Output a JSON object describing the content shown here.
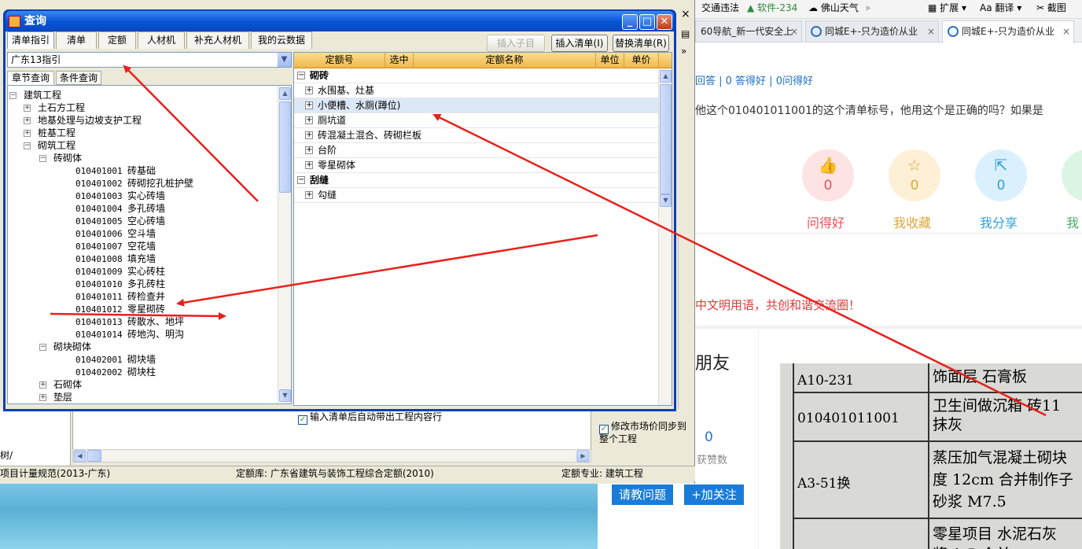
{
  "browser": {
    "bookmarks": [
      "交通违法",
      "软件-234",
      "佛山天气",
      "»",
      "扩展",
      "翻译",
      "截图"
    ],
    "tabs": [
      {
        "label": "60导航_新一代安全上",
        "close": "×"
      },
      {
        "label": "同城E+-只为造价从业",
        "close": "×"
      },
      {
        "label": "同城E+-只为造价从业",
        "close": "×"
      }
    ]
  },
  "page": {
    "stats": "回答 | 0 答得好 | 0问得好",
    "question": "他这个010401011001的这个清单标号，他用这个是正确的吗？如果是",
    "actions": [
      {
        "count": "0",
        "label": "问得好",
        "color": "#e8505b",
        "bg": "#fde3e3"
      },
      {
        "count": "0",
        "label": "我收藏",
        "color": "#e1a53a",
        "bg": "#fdf0d6"
      },
      {
        "count": "0",
        "label": "我分享",
        "color": "#2e9fe0",
        "bg": "#daf0fc"
      },
      {
        "count": "",
        "label": "我",
        "color": "#3fb36b",
        "bg": "#dcf5e4"
      }
    ],
    "civility": "中文明用语，共创和谐交流圈！",
    "friends": "朋友",
    "likes_count": "0",
    "likes_label": "获赞数",
    "ask_button": "请教问题",
    "follow_button": "+加关注"
  },
  "photo": {
    "rows": [
      {
        "code": "A10-231",
        "desc": "饰面层 石膏板"
      },
      {
        "code": "010401011001",
        "desc": "卫生间做沉箱 砖11\n抹灰"
      },
      {
        "code": "A3-51换",
        "desc": "蒸压加气混凝土砌块\n度 12cm 合并制作子\n砂浆 M7.5"
      },
      {
        "code": "",
        "desc": "零星项目 水泥石灰\n浆 1:5 合并"
      }
    ]
  },
  "app": {
    "status": {
      "norm": "项目计量规范(2013-广东)",
      "quota_lib": "定额库: 广东省建筑与装饰工程综合定额(2010)",
      "quota_major": "定额专业: 建筑工程"
    },
    "sync_option": "修改市场价同步到整个工程",
    "side_tab": "树/"
  },
  "dialog": {
    "title": "查询",
    "tabs": [
      "清单指引",
      "清单",
      "定额",
      "人材机",
      "补充人材机",
      "我的云数据"
    ],
    "active_tab": "清单指引",
    "buttons": {
      "insert_child": "插入子目",
      "insert_list": "插入清单(I)",
      "replace_list": "替换清单(R)"
    },
    "combo_value": "广东13指引",
    "subtabs": [
      "章节查询",
      "条件查询"
    ],
    "tree": [
      {
        "level": 0,
        "toggle": "−",
        "label": "建筑工程"
      },
      {
        "level": 1,
        "toggle": "+",
        "label": "土石方工程"
      },
      {
        "level": 1,
        "toggle": "+",
        "label": "地基处理与边坡支护工程"
      },
      {
        "level": 1,
        "toggle": "+",
        "label": "桩基工程"
      },
      {
        "level": 1,
        "toggle": "−",
        "label": "砌筑工程"
      },
      {
        "level": 2,
        "toggle": "−",
        "label": "砖砌体"
      },
      {
        "level": 3,
        "code": "010401001",
        "label": "砖基础"
      },
      {
        "level": 3,
        "code": "010401002",
        "label": "砖砌挖孔桩护壁"
      },
      {
        "level": 3,
        "code": "010401003",
        "label": "实心砖墙"
      },
      {
        "level": 3,
        "code": "010401004",
        "label": "多孔砖墙"
      },
      {
        "level": 3,
        "code": "010401005",
        "label": "空心砖墙"
      },
      {
        "level": 3,
        "code": "010401006",
        "label": "空斗墙"
      },
      {
        "level": 3,
        "code": "010401007",
        "label": "空花墙"
      },
      {
        "level": 3,
        "code": "010401008",
        "label": "填充墙"
      },
      {
        "level": 3,
        "code": "010401009",
        "label": "实心砖柱"
      },
      {
        "level": 3,
        "code": "010401010",
        "label": "多孔砖柱"
      },
      {
        "level": 3,
        "code": "010401011",
        "label": "砖检查井"
      },
      {
        "level": 3,
        "code": "010401012",
        "label": "零星砌砖"
      },
      {
        "level": 3,
        "code": "010401013",
        "label": "砖散水、地坪"
      },
      {
        "level": 3,
        "code": "010401014",
        "label": "砖地沟、明沟"
      },
      {
        "level": 2,
        "toggle": "−",
        "label": "砌块砌体"
      },
      {
        "level": 3,
        "code": "010402001",
        "label": "砌块墙"
      },
      {
        "level": 3,
        "code": "010402002",
        "label": "砌块柱"
      },
      {
        "level": 2,
        "toggle": "+",
        "label": "石砌体"
      },
      {
        "level": 2,
        "toggle": "+",
        "label": "垫层"
      }
    ],
    "grid_headers": [
      "定额号",
      "选中",
      "定额名称",
      "单位",
      "单价"
    ],
    "grid_rows": [
      {
        "group": true,
        "toggle": "−",
        "label": "砌砖"
      },
      {
        "toggle": "+",
        "label": "水围基、灶基"
      },
      {
        "toggle": "+",
        "label": "小便槽、水厕(蹲位)",
        "selected": true
      },
      {
        "toggle": "+",
        "label": "厕坑道"
      },
      {
        "toggle": "+",
        "label": "砖混凝土混合、砖砌栏板"
      },
      {
        "toggle": "+",
        "label": "台阶"
      },
      {
        "toggle": "+",
        "label": "零星砌体"
      },
      {
        "group": true,
        "toggle": "−",
        "label": "刮缝"
      },
      {
        "toggle": "+",
        "label": "勾缝"
      }
    ],
    "auto_bring": "输入清单后自动带出工程内容行"
  },
  "annotation_color": "#e8201c"
}
